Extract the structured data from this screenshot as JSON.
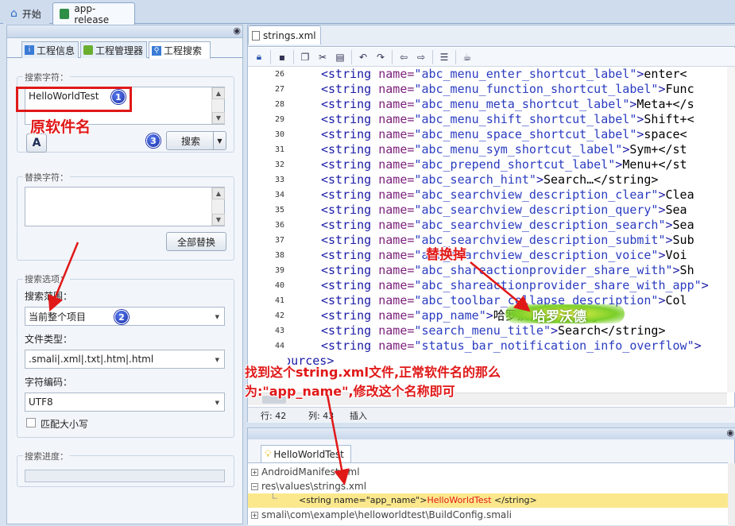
{
  "top_tabs": {
    "start": "开始",
    "app": "app-release"
  },
  "left": {
    "subtabs": [
      "工程信息",
      "工程管理器",
      "工程搜索"
    ],
    "search_group_label": "搜索字符：",
    "search_text": "HelloWorldTest",
    "search_button": "搜索",
    "replace_group_label": "替换字符：",
    "replace_all_button": "全部替换",
    "options_group_label": "搜索选项：",
    "scope_label": "搜索范围：",
    "scope_value": "当前整个项目",
    "filetype_label": "文件类型：",
    "filetype_value": ".smali|.xml|.txt|.htm|.html",
    "encoding_label": "字符编码：",
    "encoding_value": "UTF8",
    "match_case_label": "匹配大小写",
    "progress_label": "搜索进度："
  },
  "editor": {
    "tab": "strings.xml",
    "lines": [
      {
        "n": "26",
        "name": "abc_menu_enter_shortcut_label",
        "rest": "enter<"
      },
      {
        "n": "27",
        "name": "abc_menu_function_shortcut_label",
        "rest": "Func"
      },
      {
        "n": "28",
        "name": "abc_menu_meta_shortcut_label",
        "rest": "Meta+</s"
      },
      {
        "n": "29",
        "name": "abc_menu_shift_shortcut_label",
        "rest": "Shift+<"
      },
      {
        "n": "30",
        "name": "abc_menu_space_shortcut_label",
        "rest": "space<"
      },
      {
        "n": "31",
        "name": "abc_menu_sym_shortcut_label",
        "rest": "Sym+</st"
      },
      {
        "n": "32",
        "name": "abc_prepend_shortcut_label",
        "rest": "Menu+</st"
      },
      {
        "n": "33",
        "name": "abc_search_hint",
        "rest": "Search…</string>"
      },
      {
        "n": "34",
        "name": "abc_searchview_description_clear",
        "rest": "Clea"
      },
      {
        "n": "35",
        "name": "abc_searchview_description_query",
        "rest": "Sea"
      },
      {
        "n": "36",
        "name": "abc_searchview_description_search",
        "rest": "Sea"
      },
      {
        "n": "37",
        "name": "abc_searchview_description_submit",
        "rest": "Sub"
      },
      {
        "n": "38",
        "name": "abc_searchview_description_voice",
        "rest": "Voi"
      },
      {
        "n": "39",
        "name": "abc_shareactionprovider_share_with",
        "rest": "Sh"
      },
      {
        "n": "40",
        "name": "abc_shareactionprovider_share_with_app",
        "rest": ""
      },
      {
        "n": "41",
        "name": "abc_toolbar_collapse_description",
        "rest": "Col"
      },
      {
        "n": "42",
        "name": "app_name",
        "rest": "哈罗沃德</string>"
      },
      {
        "n": "43",
        "name": "search_menu_title",
        "rest": "Search</string>"
      },
      {
        "n": "44",
        "name": "status_bar_notification_info_overflow",
        "rest": ""
      }
    ],
    "closing_line": "</resources>",
    "status_line": "行: 42",
    "status_col": "列: 43",
    "status_mode": "插入"
  },
  "results": {
    "tab": "HelloWorldTest",
    "items": [
      {
        "text": "AndroidManifest.xml",
        "expander": "+"
      },
      {
        "text": "res\\values\\strings.xml",
        "expander": "−"
      },
      {
        "text": "smali\\com\\example\\helloworldtest\\BuildConfig.smali",
        "expander": "+"
      }
    ],
    "match_prefix": "<string name=\"app_name\">",
    "match_value": "HelloWorldTest",
    "match_suffix": " </string>"
  },
  "annotations": {
    "badge1": "1",
    "badge2": "2",
    "badge3": "3",
    "original_name": "原软件名",
    "replace_label": "替换掉",
    "new_name": "哈罗沃德",
    "explain_line1": "找到这个string.xml文件,正常软件名的那么",
    "explain_line2": "为:\"app_name\",修改这个名称即可"
  },
  "colors": {
    "annotation_red": "#e01818",
    "match_highlight": "#fbe88c"
  }
}
